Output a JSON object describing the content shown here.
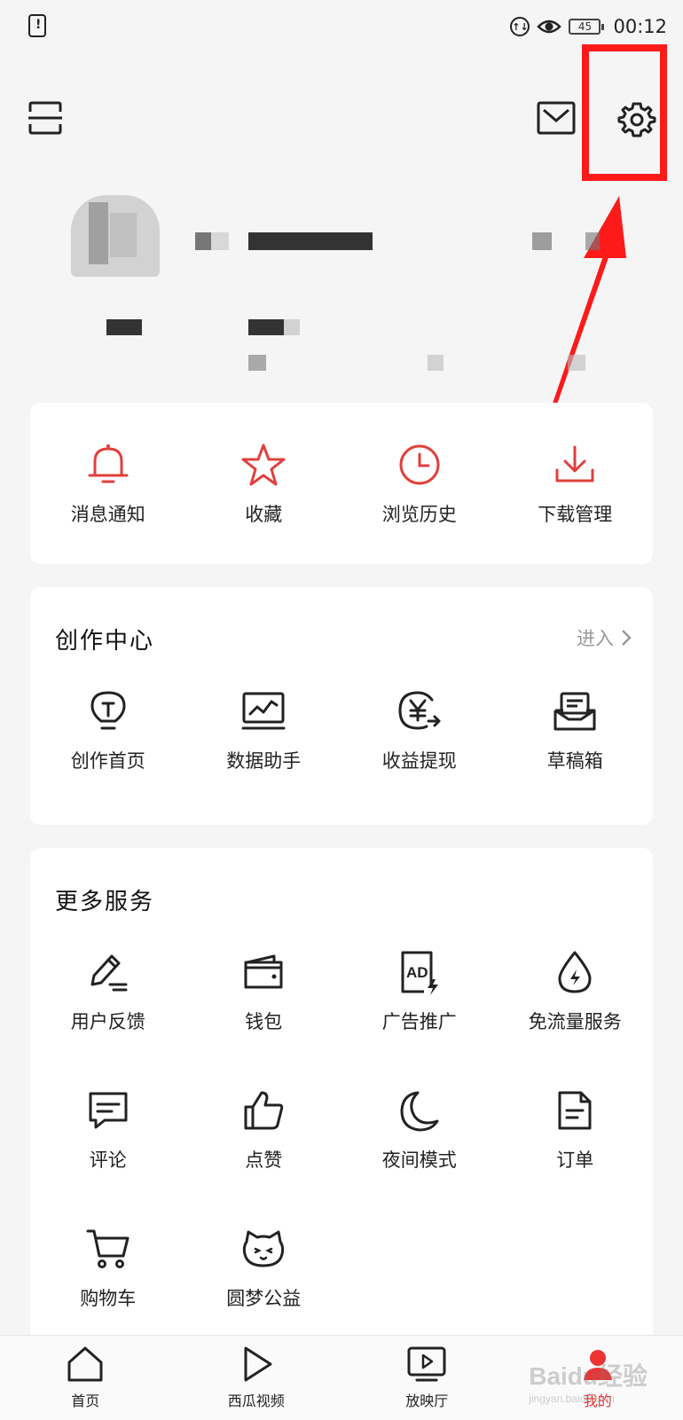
{
  "status_bar": {
    "battery": "45",
    "time": "00:12"
  },
  "quick_actions": [
    {
      "label": "消息通知",
      "icon": "bell-icon"
    },
    {
      "label": "收藏",
      "icon": "star-icon"
    },
    {
      "label": "浏览历史",
      "icon": "clock-icon"
    },
    {
      "label": "下载管理",
      "icon": "download-icon"
    }
  ],
  "creator_center": {
    "title": "创作中心",
    "enter_label": "进入",
    "items": [
      {
        "label": "创作首页",
        "icon": "lightbulb-icon"
      },
      {
        "label": "数据助手",
        "icon": "chart-monitor-icon"
      },
      {
        "label": "收益提现",
        "icon": "yen-withdraw-icon"
      },
      {
        "label": "草稿箱",
        "icon": "draft-box-icon"
      }
    ]
  },
  "more_services": {
    "title": "更多服务",
    "items": [
      {
        "label": "用户反馈",
        "icon": "pen-feedback-icon"
      },
      {
        "label": "钱包",
        "icon": "wallet-icon"
      },
      {
        "label": "广告推广",
        "icon": "ad-icon"
      },
      {
        "label": "免流量服务",
        "icon": "drop-data-icon"
      },
      {
        "label": "评论",
        "icon": "comment-icon"
      },
      {
        "label": "点赞",
        "icon": "thumbs-up-icon"
      },
      {
        "label": "夜间模式",
        "icon": "moon-icon"
      },
      {
        "label": "订单",
        "icon": "order-document-icon"
      },
      {
        "label": "购物车",
        "icon": "cart-icon"
      },
      {
        "label": "圆梦公益",
        "icon": "charity-cat-icon"
      }
    ]
  },
  "bottom_nav": [
    {
      "label": "首页",
      "icon": "home-icon",
      "active": false
    },
    {
      "label": "西瓜视频",
      "icon": "play-icon",
      "active": false
    },
    {
      "label": "放映厅",
      "icon": "tv-play-icon",
      "active": false
    },
    {
      "label": "我的",
      "icon": "profile-icon",
      "active": true
    }
  ],
  "watermark": {
    "text": "Baidu经验",
    "url": "jingyan.baidu.com"
  },
  "colors": {
    "accent_red": "#e0403c",
    "annotation_red": "#ff1a1a",
    "background": "#f5f5f5",
    "card": "#ffffff"
  }
}
